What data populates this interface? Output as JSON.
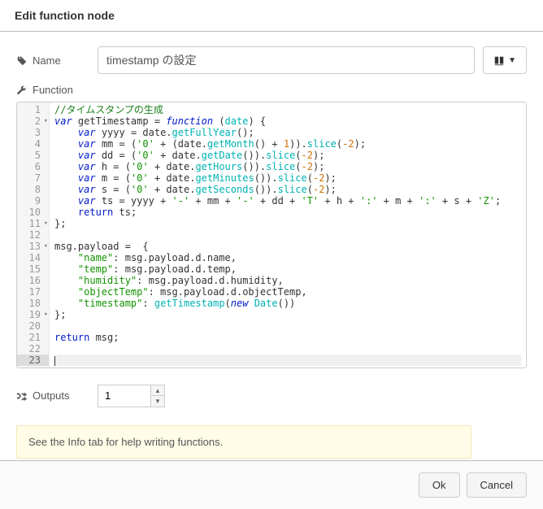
{
  "header": {
    "title": "Edit function node"
  },
  "name_field": {
    "label": "Name",
    "value": "timestamp の設定"
  },
  "func_field": {
    "label": "Function"
  },
  "outputs_field": {
    "label": "Outputs",
    "value": "1"
  },
  "info_box": {
    "text": "See the Info tab for help writing functions."
  },
  "footer": {
    "ok": "Ok",
    "cancel": "Cancel"
  },
  "code_lines": [
    {
      "n": 1,
      "fold": false,
      "html": "<span class='c-comment'>//タイムスタンプの生成</span>"
    },
    {
      "n": 2,
      "fold": true,
      "html": "<span class='c-key'>var</span> getTimestamp = <span class='c-key'>function</span> <span class='c-paren'>(</span><span class='c-func'>date</span><span class='c-paren'>)</span> <span class='c-paren'>{</span>"
    },
    {
      "n": 3,
      "fold": false,
      "html": "    <span class='c-key'>var</span> yyyy = date.<span class='c-func'>getFullYear</span><span class='c-paren'>()</span>;"
    },
    {
      "n": 4,
      "fold": false,
      "html": "    <span class='c-key'>var</span> mm = <span class='c-paren'>(</span><span class='c-str'>'0'</span> + <span class='c-paren'>(</span>date.<span class='c-func'>getMonth</span><span class='c-paren'>()</span> + <span class='c-num'>1</span><span class='c-paren'>))</span>.<span class='c-func'>slice</span><span class='c-paren'>(</span><span class='c-num'>-2</span><span class='c-paren'>)</span>;"
    },
    {
      "n": 5,
      "fold": false,
      "html": "    <span class='c-key'>var</span> dd = <span class='c-paren'>(</span><span class='c-str'>'0'</span> + date.<span class='c-func'>getDate</span><span class='c-paren'>())</span>.<span class='c-func'>slice</span><span class='c-paren'>(</span><span class='c-num'>-2</span><span class='c-paren'>)</span>;"
    },
    {
      "n": 6,
      "fold": false,
      "html": "    <span class='c-key'>var</span> h = <span class='c-paren'>(</span><span class='c-str'>'0'</span> + date.<span class='c-func'>getHours</span><span class='c-paren'>())</span>.<span class='c-func'>slice</span><span class='c-paren'>(</span><span class='c-num'>-2</span><span class='c-paren'>)</span>;"
    },
    {
      "n": 7,
      "fold": false,
      "html": "    <span class='c-key'>var</span> m = <span class='c-paren'>(</span><span class='c-str'>'0'</span> + date.<span class='c-func'>getMinutes</span><span class='c-paren'>())</span>.<span class='c-func'>slice</span><span class='c-paren'>(</span><span class='c-num'>-2</span><span class='c-paren'>)</span>;"
    },
    {
      "n": 8,
      "fold": false,
      "html": "    <span class='c-key'>var</span> s = <span class='c-paren'>(</span><span class='c-str'>'0'</span> + date.<span class='c-func'>getSeconds</span><span class='c-paren'>())</span>.<span class='c-func'>slice</span><span class='c-paren'>(</span><span class='c-num'>-2</span><span class='c-paren'>)</span>;"
    },
    {
      "n": 9,
      "fold": false,
      "html": "    <span class='c-key'>var</span> ts = yyyy + <span class='c-str'>'-'</span> + mm + <span class='c-str'>'-'</span> + dd + <span class='c-str'>'T'</span> + h + <span class='c-str'>':'</span> + m + <span class='c-str'>':'</span> + s + <span class='c-str'>'Z'</span>;"
    },
    {
      "n": 10,
      "fold": false,
      "html": "    <span class='c-keyword'>return</span> ts;"
    },
    {
      "n": 11,
      "fold": true,
      "html": "<span class='c-paren'>}</span>;"
    },
    {
      "n": 12,
      "fold": false,
      "html": ""
    },
    {
      "n": 13,
      "fold": true,
      "html": "msg.payload =  <span class='c-paren'>{</span>"
    },
    {
      "n": 14,
      "fold": false,
      "html": "    <span class='c-str'>\"name\"</span>: msg.payload.d.name,"
    },
    {
      "n": 15,
      "fold": false,
      "html": "    <span class='c-str'>\"temp\"</span>: msg.payload.d.temp,"
    },
    {
      "n": 16,
      "fold": false,
      "html": "    <span class='c-str'>\"humidity\"</span>: msg.payload.d.humidity,"
    },
    {
      "n": 17,
      "fold": false,
      "html": "    <span class='c-str'>\"objectTemp\"</span>: msg.payload.d.objectTemp,"
    },
    {
      "n": 18,
      "fold": false,
      "html": "    <span class='c-str'>\"timestamp\"</span>: <span class='c-func'>getTimestamp</span><span class='c-paren'>(</span><span class='c-key'>new</span> <span class='c-func'>Date</span><span class='c-paren'>())</span>"
    },
    {
      "n": 19,
      "fold": true,
      "html": "<span class='c-paren'>}</span>;"
    },
    {
      "n": 20,
      "fold": false,
      "html": ""
    },
    {
      "n": 21,
      "fold": false,
      "html": "<span class='c-keyword'>return</span> msg;"
    },
    {
      "n": 22,
      "fold": false,
      "html": ""
    },
    {
      "n": 23,
      "fold": false,
      "html": "<span class='c-cursor'></span>",
      "active": true
    }
  ]
}
